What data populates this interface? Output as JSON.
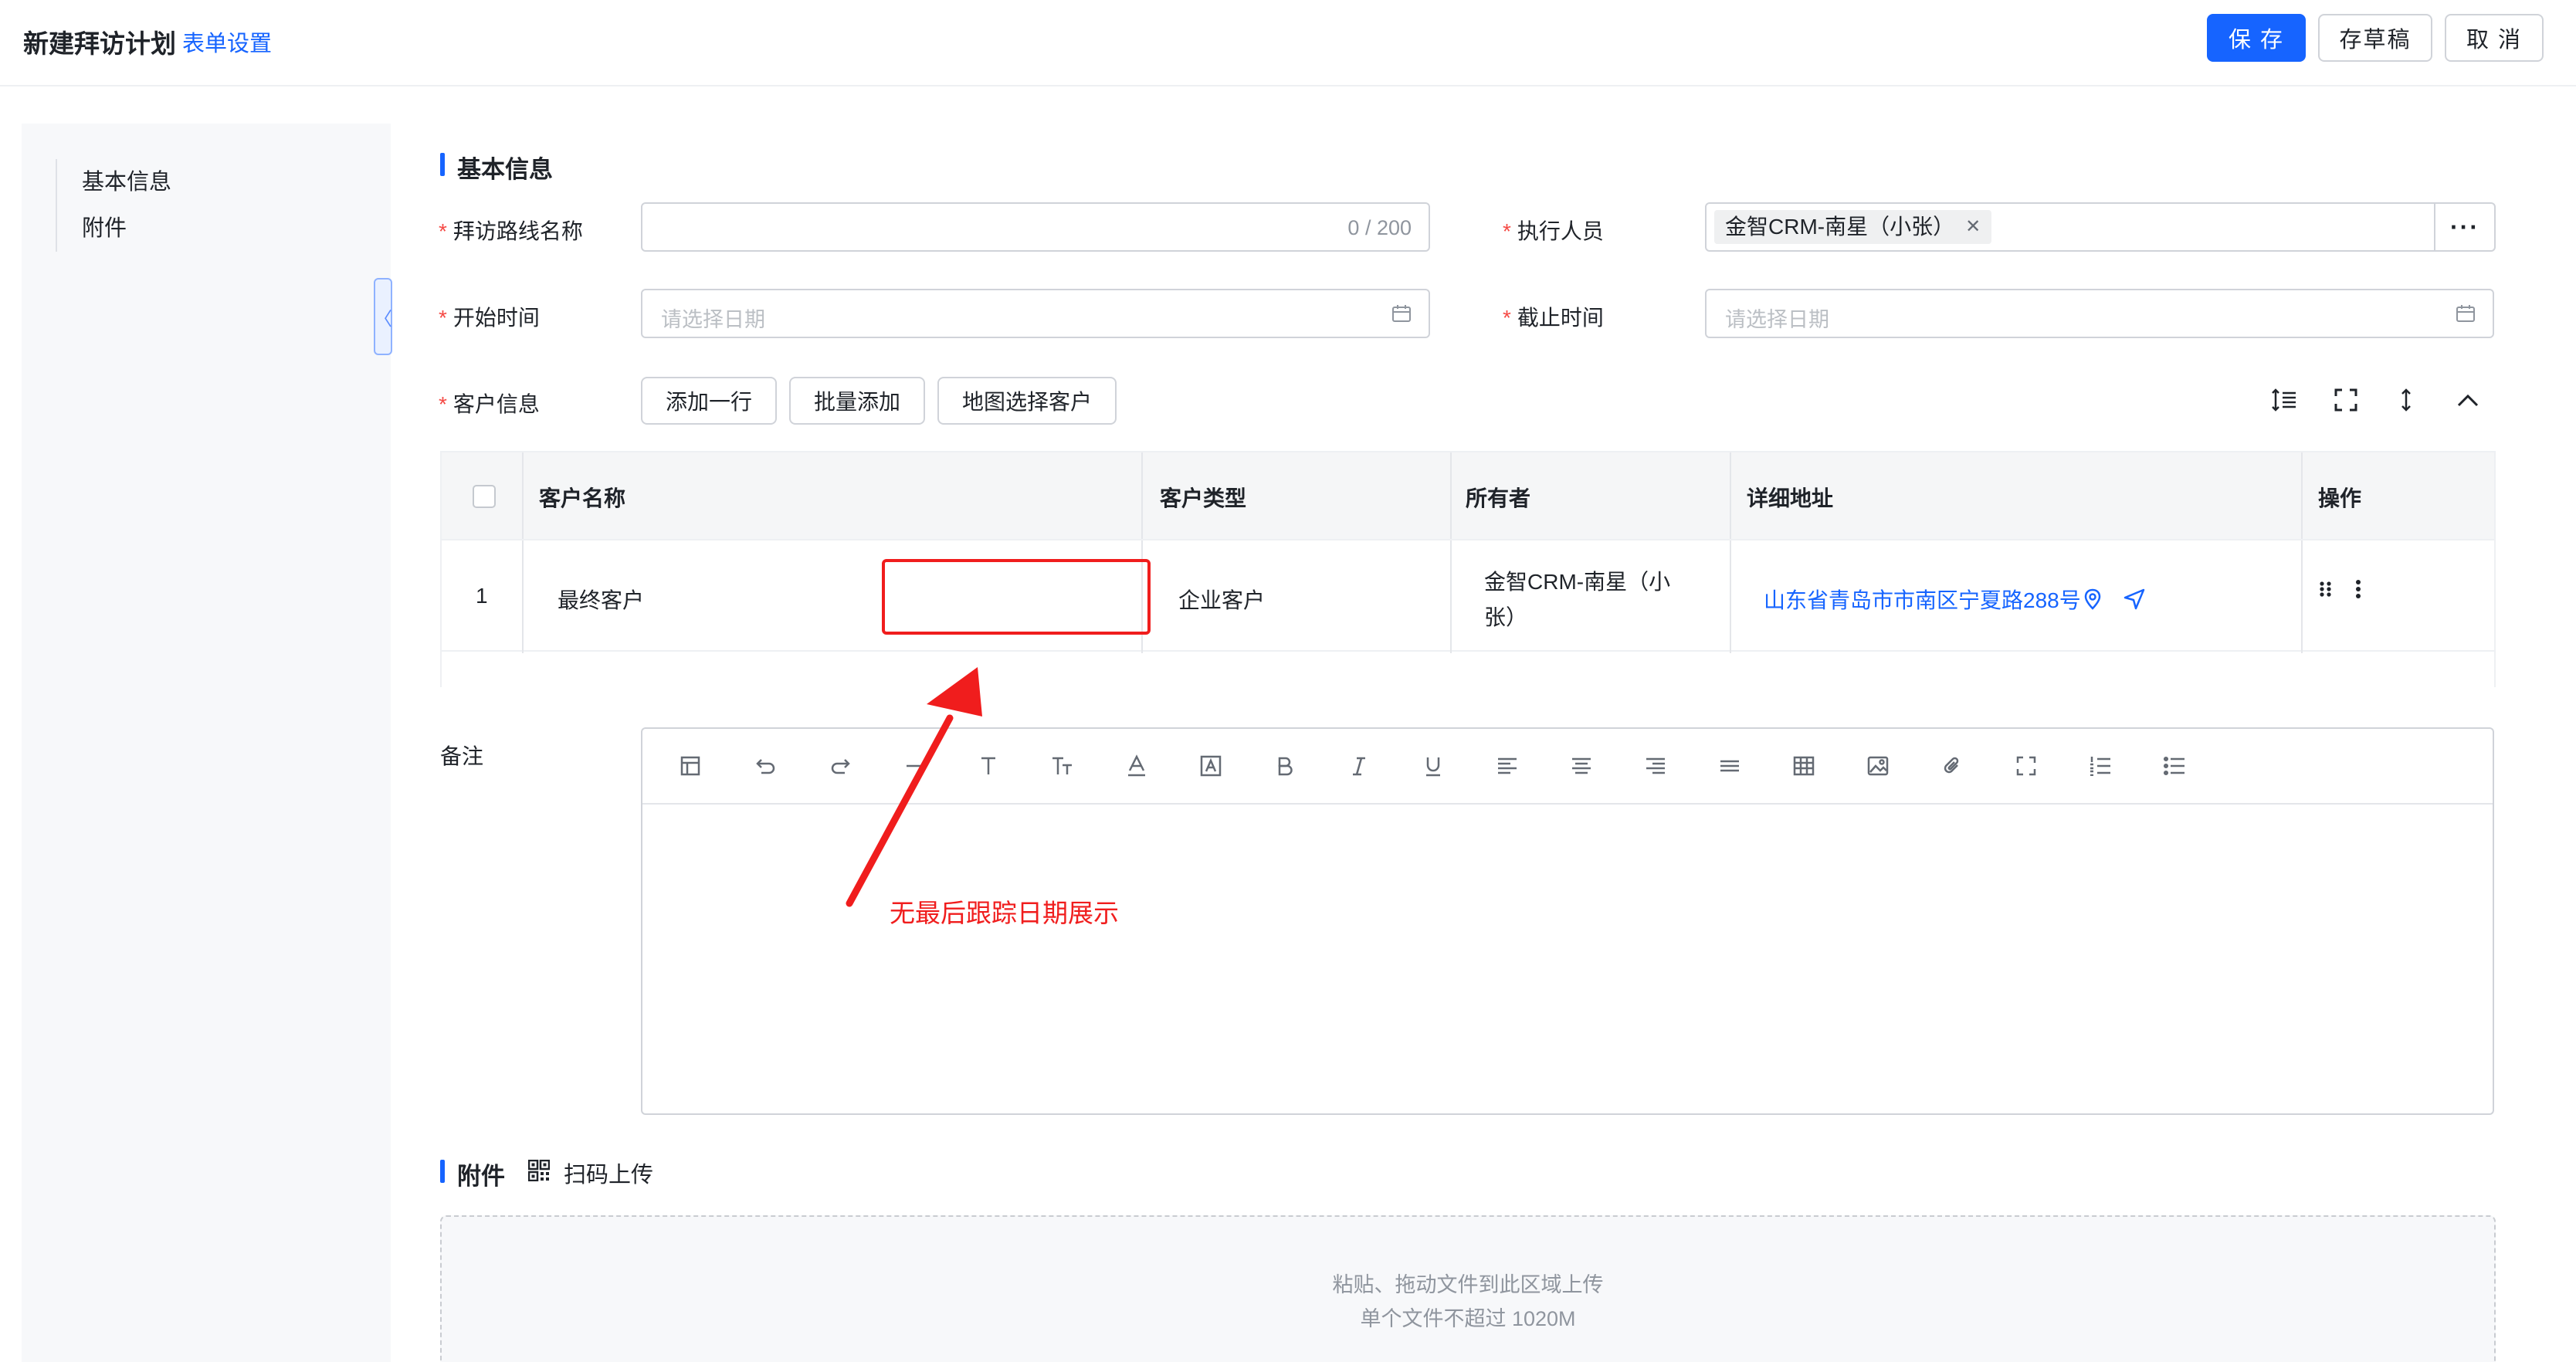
{
  "header": {
    "title": "新建拜访计划",
    "form_settings": "表单设置",
    "save": "保 存",
    "draft": "存草稿",
    "cancel": "取 消"
  },
  "sidebar": {
    "items": [
      {
        "label": "基本信息"
      },
      {
        "label": "附件"
      }
    ]
  },
  "basic_info": {
    "section_title": "基本信息",
    "route_name": {
      "label": "拜访路线名称",
      "value": "",
      "counter": "0 / 200"
    },
    "executor": {
      "label": "执行人员",
      "tag": "金智CRM-南星（小张）"
    },
    "start_time": {
      "label": "开始时间",
      "placeholder": "请选择日期"
    },
    "end_time": {
      "label": "截止时间",
      "placeholder": "请选择日期"
    },
    "customer_info": {
      "label": "客户信息",
      "add_row": "添加一行",
      "batch_add": "批量添加",
      "map_select": "地图选择客户"
    }
  },
  "table": {
    "columns": [
      "客户名称",
      "客户类型",
      "所有者",
      "详细地址",
      "操作"
    ],
    "rows": [
      {
        "index": "1",
        "name": "最终客户",
        "type": "企业客户",
        "owner_line1": "金智CRM-南星（小",
        "owner_line2": "张）",
        "address": "山东省青岛市市南区宁夏路288号"
      }
    ]
  },
  "remarks": {
    "label": "备注"
  },
  "annotation": {
    "text": "无最后跟踪日期展示",
    "color": "#f01d1d"
  },
  "attachments": {
    "section_title": "附件",
    "scan_upload": "扫码上传",
    "hint_line1": "粘贴、拖动文件到此区域上传",
    "hint_line2": "单个文件不超过 1020M"
  },
  "colors": {
    "accent": "#1664ff",
    "required": "#f54a45"
  }
}
